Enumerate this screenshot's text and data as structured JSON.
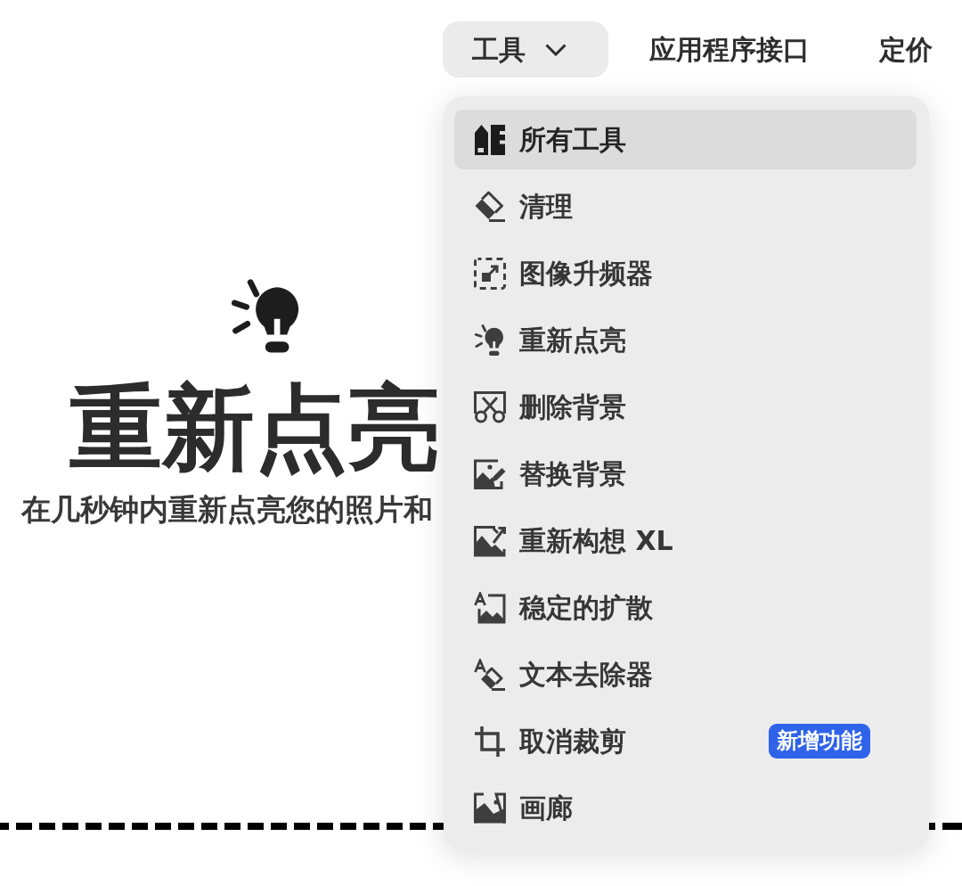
{
  "nav": {
    "tools_menu": {
      "label": "工具",
      "expanded": true,
      "items": [
        {
          "label": "所有工具",
          "selected": true
        },
        {
          "label": "清理",
          "selected": false
        },
        {
          "label": "图像升频器",
          "selected": false
        },
        {
          "label": "重新点亮",
          "selected": false
        },
        {
          "label": "删除背景",
          "selected": false
        },
        {
          "label": "替换背景",
          "selected": false
        },
        {
          "label": "重新构想 XL",
          "selected": false
        },
        {
          "label": "稳定的扩散",
          "selected": false
        },
        {
          "label": "文本去除器",
          "selected": false
        },
        {
          "label": "取消裁剪",
          "selected": false,
          "badge": "新增功能"
        },
        {
          "label": "画廊",
          "selected": false
        }
      ]
    },
    "links": [
      {
        "label": "应用程序接口"
      },
      {
        "label": "定价"
      }
    ]
  },
  "hero": {
    "title": "重新点亮",
    "subtitle": "在几秒钟内重新点亮您的照片和"
  }
}
